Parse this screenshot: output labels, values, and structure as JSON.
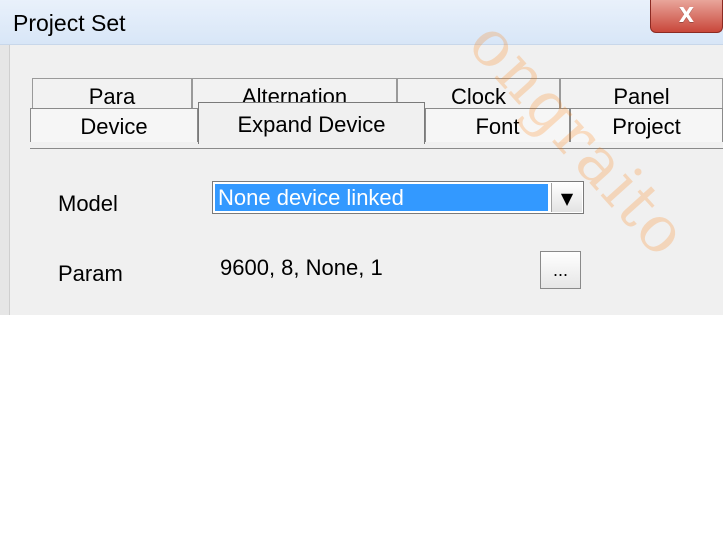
{
  "window": {
    "title": "Project Set",
    "close_glyph": "X"
  },
  "tabs": {
    "back_row": [
      {
        "label": "Para"
      },
      {
        "label": "Alternation"
      },
      {
        "label": "Clock"
      },
      {
        "label": "Panel"
      }
    ],
    "front_row": [
      {
        "label": "Device"
      },
      {
        "label": "Expand Device",
        "selected": true
      },
      {
        "label": "Font"
      },
      {
        "label": "Project"
      }
    ]
  },
  "form": {
    "model_label": "Model",
    "model_selected": "None device linked",
    "param_label": "Param",
    "param_value": "9600, 8, None, 1",
    "param_button": "..."
  },
  "watermark": {
    "text": "ongraito"
  },
  "colors": {
    "selection": "#3399ff",
    "close_button_red": "#c9473a",
    "watermark_orange": "#ff7a00"
  },
  "icons": {
    "close": "close-icon",
    "dropdown_arrow": "dropdown-arrow-icon"
  }
}
